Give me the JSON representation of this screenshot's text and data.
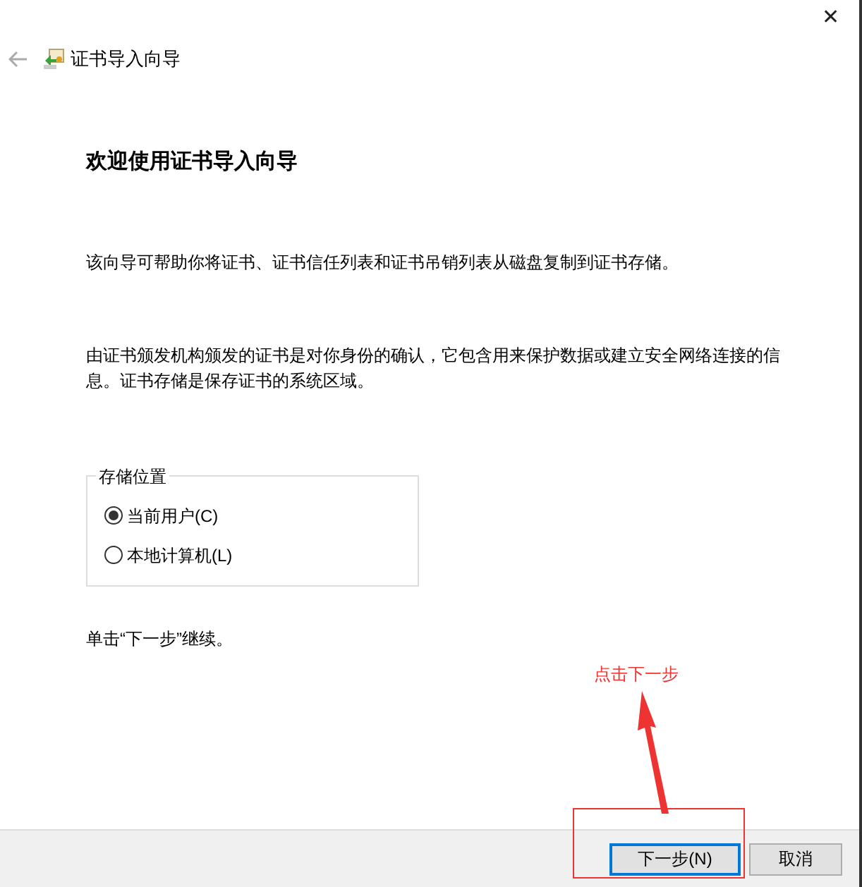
{
  "window": {
    "title": "证书导入向导",
    "close": "✕"
  },
  "heading": "欢迎使用证书导入向导",
  "paragraphs": [
    "该向导可帮助你将证书、证书信任列表和证书吊销列表从磁盘复制到证书存储。",
    "由证书颁发机构颁发的证书是对你身份的确认，它包含用来保护数据或建立安全网络连接的信息。证书存储是保存证书的系统区域。"
  ],
  "store_location": {
    "label": "存储位置",
    "options": [
      {
        "label": "当前用户(C)",
        "selected": true
      },
      {
        "label": "本地计算机(L)",
        "selected": false
      }
    ]
  },
  "hint": "单击“下一步”继续。",
  "annotation": {
    "text": "点击下一步"
  },
  "buttons": [
    {
      "label": "下一步(N)",
      "focused": true
    },
    {
      "label": "取消",
      "focused": false
    }
  ]
}
